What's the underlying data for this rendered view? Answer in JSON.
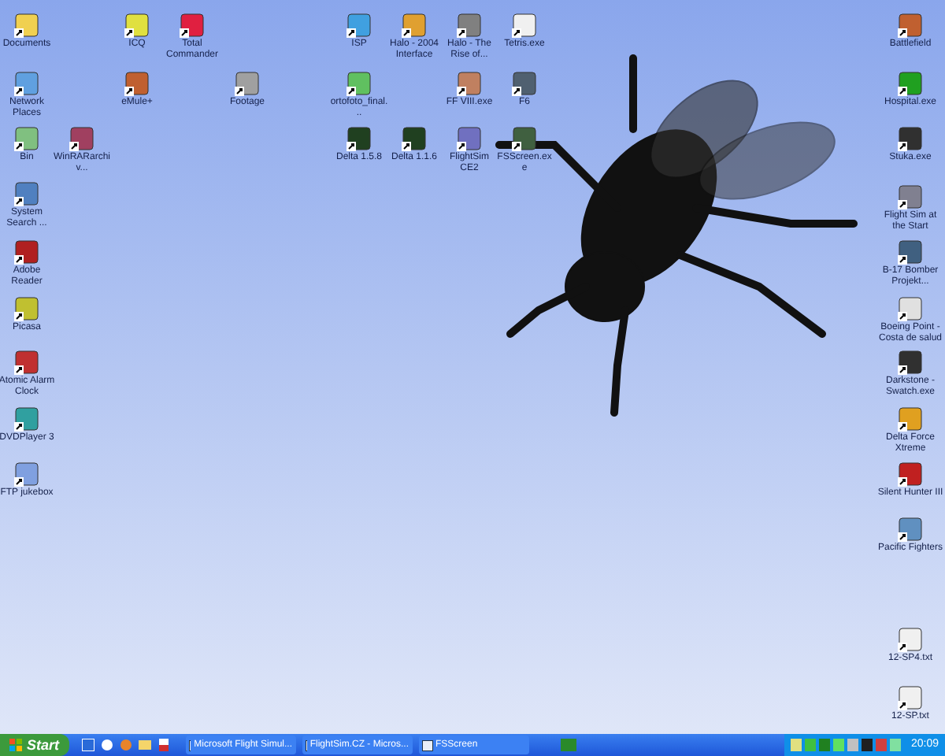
{
  "desktop_icons": [
    {
      "label": "Documents"
    },
    {
      "label": "Network Places"
    },
    {
      "label": "Bin"
    },
    {
      "label": "WinRARarchiv..."
    },
    {
      "label": "System Search ..."
    },
    {
      "label": "Adobe Reader"
    },
    {
      "label": "Picasa"
    },
    {
      "label": "Atomic Alarm Clock"
    },
    {
      "label": "DVDPlayer 3"
    },
    {
      "label": "FTP jukebox"
    },
    {
      "label": "ICQ"
    },
    {
      "label": "eMule+"
    },
    {
      "label": "Total Commander"
    },
    {
      "label": "Footage"
    },
    {
      "label": "ISP"
    },
    {
      "label": "Halo - 2004 Interface"
    },
    {
      "label": "Halo - The Rise of..."
    },
    {
      "label": "Tetris.exe"
    },
    {
      "label": "ortofoto_final..."
    },
    {
      "label": "FF VIII.exe"
    },
    {
      "label": "F6"
    },
    {
      "label": "Delta 1.5.8"
    },
    {
      "label": "Delta 1.1.6"
    },
    {
      "label": "FlightSim CE2"
    },
    {
      "label": "FSScreen.exe"
    },
    {
      "label": "Battlefield"
    },
    {
      "label": "Hospital.exe"
    },
    {
      "label": "Stuka.exe"
    },
    {
      "label": "Flight Sim at the Start"
    },
    {
      "label": "B-17 Bomber Projekt..."
    },
    {
      "label": "Boeing Point - Costa de salud"
    },
    {
      "label": "Darkstone - Swatch.exe"
    },
    {
      "label": "Delta Force Xtreme"
    },
    {
      "label": "Silent Hunter III"
    },
    {
      "label": "Pacific Fighters"
    },
    {
      "label": "12-SP4.txt"
    },
    {
      "label": "12-SP.txt"
    }
  ],
  "taskbar": {
    "start": "Start",
    "tasks": [
      {
        "label": "Microsoft Flight Simul..."
      },
      {
        "label": "FlightSim.CZ - Micros..."
      },
      {
        "label": "FSScreen"
      }
    ],
    "clock": "20:09"
  }
}
